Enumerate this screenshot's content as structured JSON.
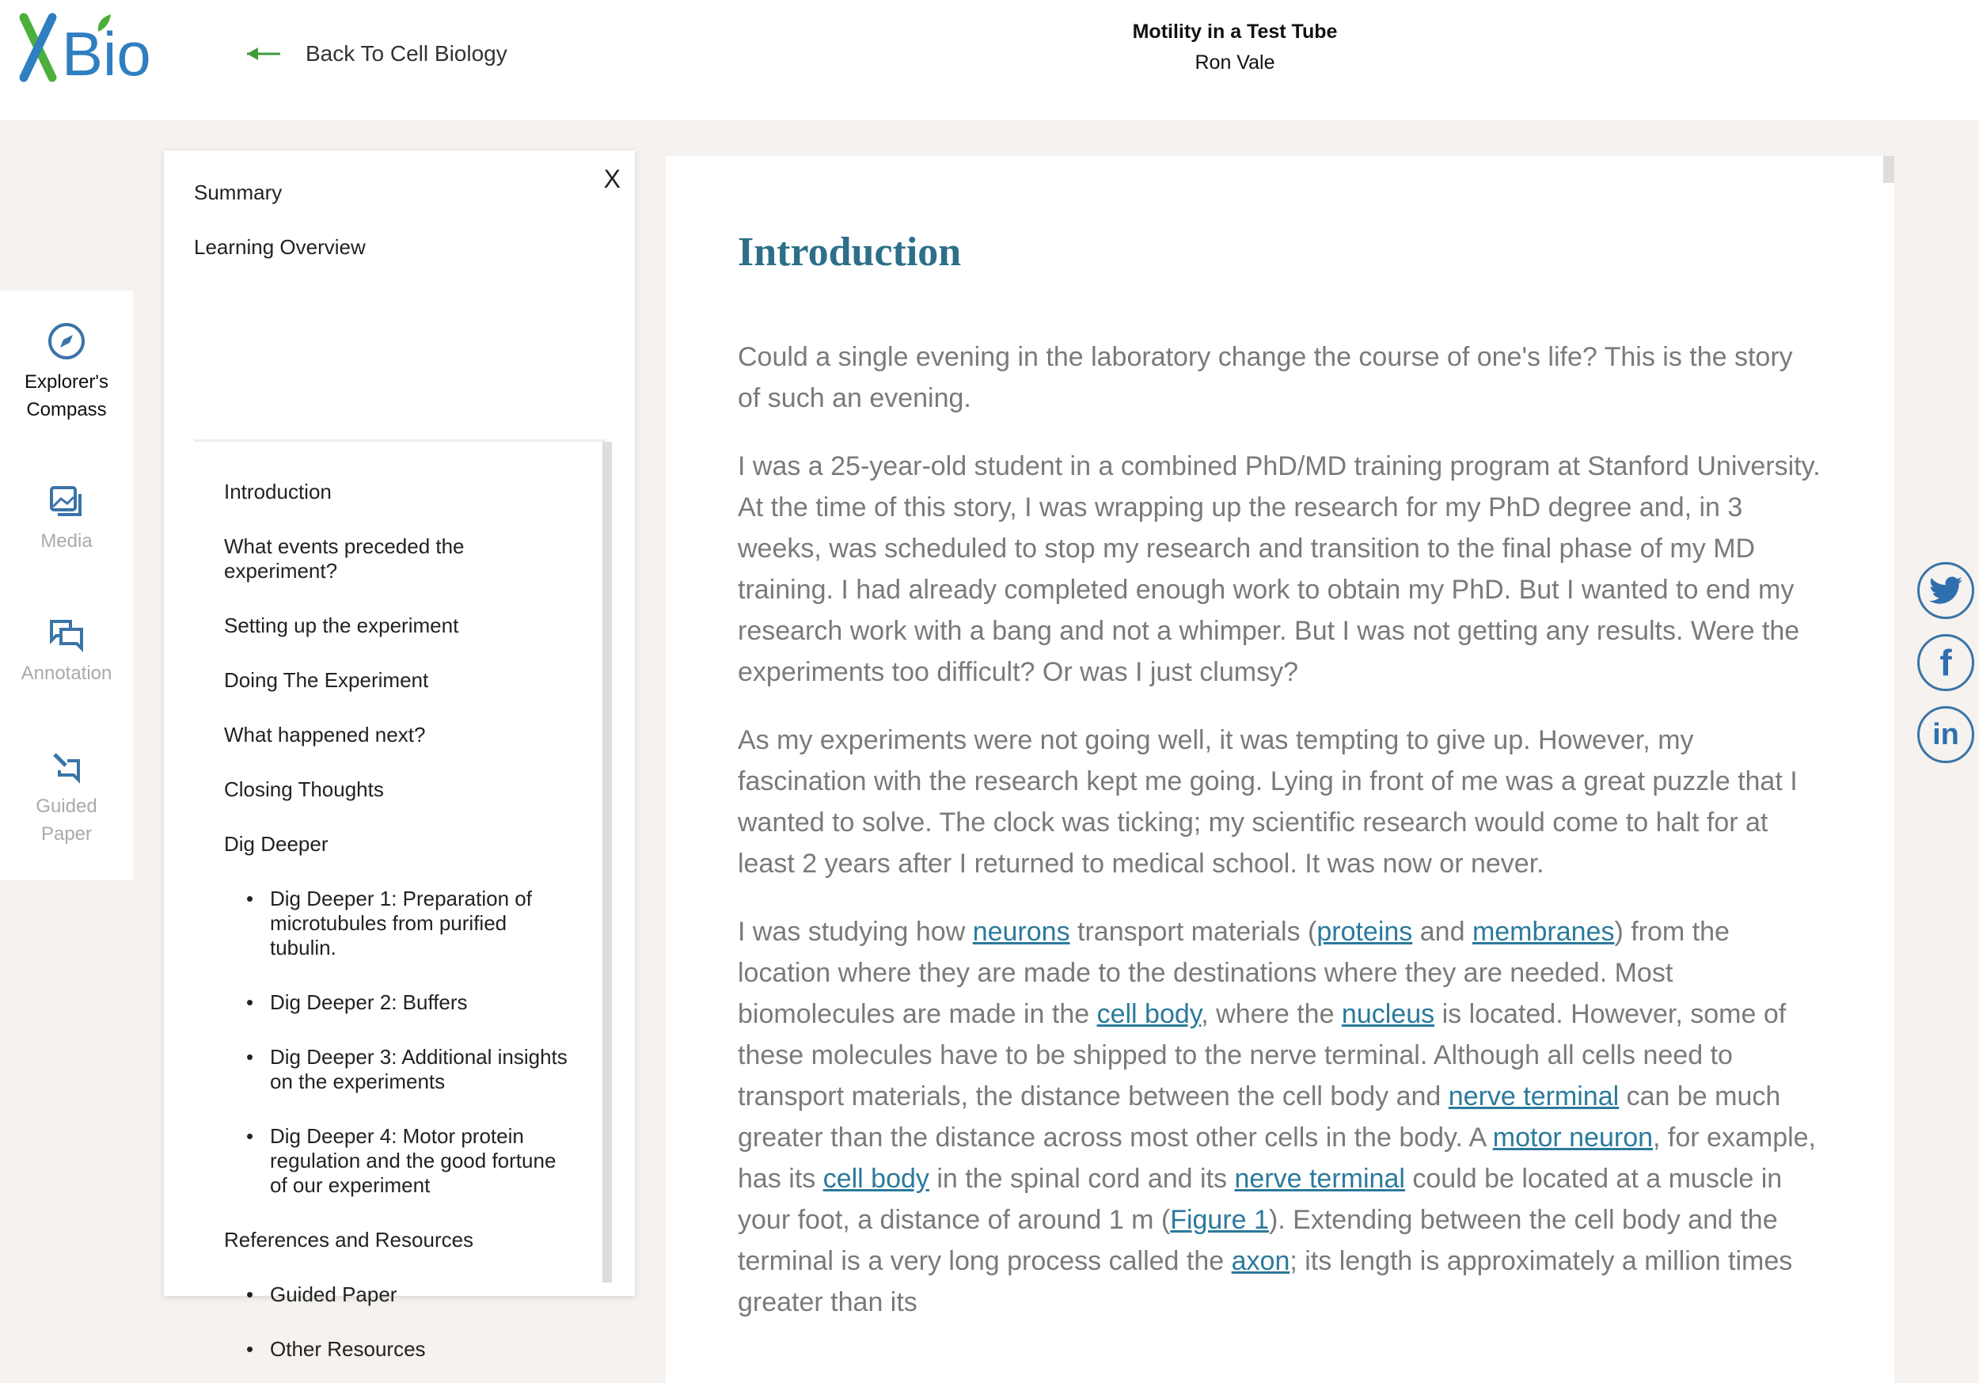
{
  "header": {
    "logo_text": "XBio",
    "back_label": "Back To Cell Biology",
    "title": "Motility in a Test Tube",
    "author": "Ron Vale"
  },
  "rail": [
    {
      "label": "Explorer's Compass",
      "icon": "compass-icon"
    },
    {
      "label": "Media",
      "icon": "image-icon"
    },
    {
      "label": "Annotation",
      "icon": "chat-icon"
    },
    {
      "label": "Guided Paper",
      "icon": "edit-icon"
    }
  ],
  "panel": {
    "close_label": "X",
    "summary": "Summary",
    "overview": "Learning Overview",
    "toc": [
      {
        "label": "Introduction",
        "sub": false
      },
      {
        "label": "What events preceded the experiment?",
        "sub": false
      },
      {
        "label": "Setting up the experiment",
        "sub": false
      },
      {
        "label": "Doing The Experiment",
        "sub": false
      },
      {
        "label": "What happened next?",
        "sub": false
      },
      {
        "label": "Closing Thoughts",
        "sub": false
      },
      {
        "label": "Dig Deeper",
        "sub": false
      },
      {
        "label": "Dig Deeper 1: Preparation of microtubules from purified tubulin.",
        "sub": true
      },
      {
        "label": "Dig Deeper 2: Buffers",
        "sub": true
      },
      {
        "label": "Dig Deeper 3: Additional insights on the experiments",
        "sub": true
      },
      {
        "label": "Dig Deeper 4: Motor protein regulation and the good fortune of our experiment",
        "sub": true
      },
      {
        "label": "References and Resources",
        "sub": false
      },
      {
        "label": "Guided Paper",
        "sub": true
      },
      {
        "label": "Other Resources",
        "sub": true
      }
    ]
  },
  "content": {
    "heading": "Introduction",
    "paragraphs": [
      [
        {
          "t": "Could a single evening in the laboratory change the course of one's life? This is the story of such an evening."
        }
      ],
      [
        {
          "t": "I was a 25-year-old student in a combined PhD/MD training program at Stanford University. At the time of this story, I was wrapping up the research for my PhD degree and, in 3 weeks, was scheduled to stop my research and transition to the final phase of my MD training. I had already completed enough work to obtain my PhD. But I wanted to end my research work with a bang and not a whimper. But I was not getting any results. Were the experiments too difficult? Or was I just clumsy?"
        }
      ],
      [
        {
          "t": "As my experiments were not going well, it was tempting to give up. However, my fascination with the research kept me going. Lying in front of me was a great puzzle that I wanted to solve. The clock was ticking; my scientific research would come to halt for at least 2 years after I returned to medical school. It was now or never."
        }
      ],
      [
        {
          "t": "I was studying how "
        },
        {
          "t": "neurons",
          "link": true
        },
        {
          "t": " transport materials ("
        },
        {
          "t": "proteins",
          "link": true
        },
        {
          "t": " and "
        },
        {
          "t": "membranes",
          "link": true
        },
        {
          "t": ") from the location where they are made to the destinations where they are needed. Most biomolecules are made in the "
        },
        {
          "t": "cell body",
          "link": true
        },
        {
          "t": ", where the "
        },
        {
          "t": "nucleus",
          "link": true
        },
        {
          "t": " is located. However, some of these molecules have to be shipped to the nerve terminal. Although all cells need to transport materials, the distance between the cell body and "
        },
        {
          "t": "nerve terminal",
          "link": true
        },
        {
          "t": " can be much greater than the distance across most other cells in the body. A "
        },
        {
          "t": "motor neuron",
          "link": true
        },
        {
          "t": ", for example, has its "
        },
        {
          "t": "cell body",
          "link": true
        },
        {
          "t": " in the spinal cord and its "
        },
        {
          "t": "nerve terminal",
          "link": true
        },
        {
          "t": " could be located at a muscle in your foot, a distance of around 1 m ("
        },
        {
          "t": "Figure 1",
          "link": true
        },
        {
          "t": "). Extending between the cell body and the terminal is a very long process called the "
        },
        {
          "t": "axon",
          "link": true
        },
        {
          "t": "; its length is approximately a million times greater than its"
        }
      ]
    ]
  },
  "social": [
    {
      "name": "twitter",
      "glyph": "🐦"
    },
    {
      "name": "facebook",
      "glyph": "f"
    },
    {
      "name": "linkedin",
      "glyph": "in"
    }
  ],
  "colors": {
    "heading": "#2d6f89",
    "link": "#2b7a9c",
    "logo_green": "#4caf3c",
    "logo_blue": "#2f7fc1"
  }
}
